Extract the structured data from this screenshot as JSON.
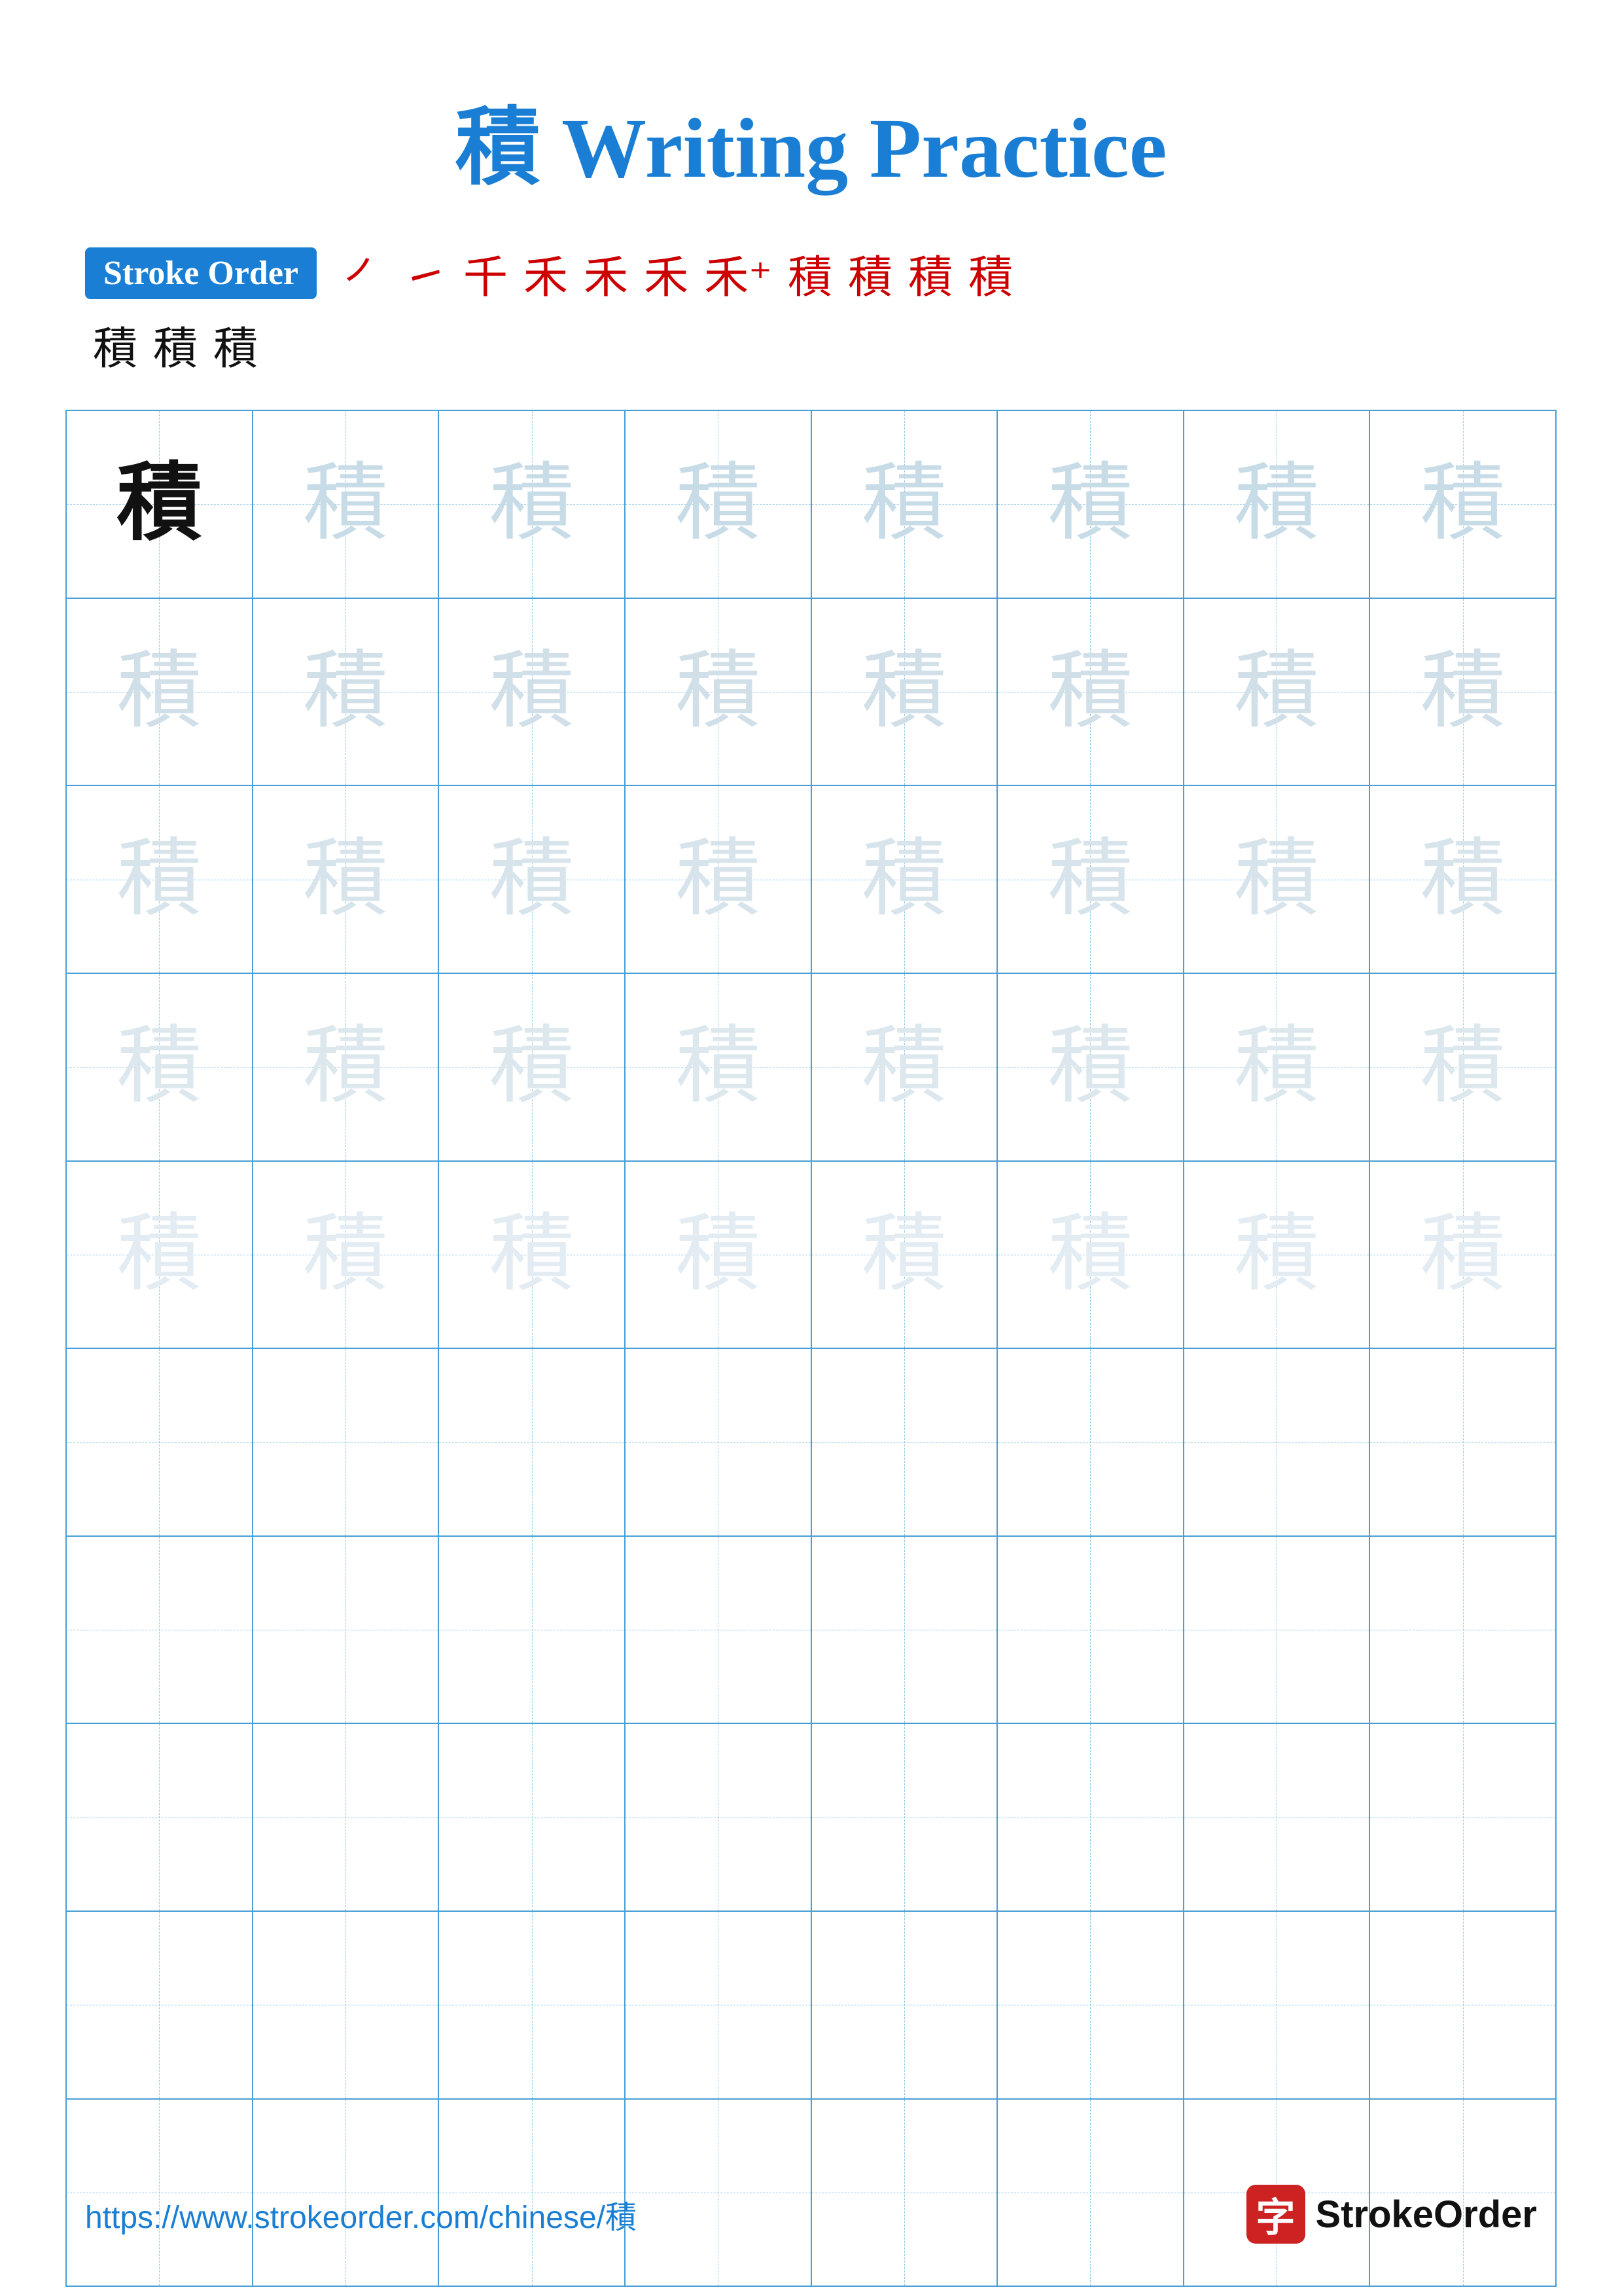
{
  "title": {
    "char": "積",
    "text": " Writing Practice"
  },
  "stroke_order": {
    "badge_label": "Stroke Order",
    "strokes": [
      "㇒",
      "㇀",
      "千",
      "禾",
      "禾",
      "禾",
      "禾†",
      "積",
      "積",
      "積",
      "積",
      "積",
      "積",
      "積"
    ]
  },
  "character": "積",
  "grid": {
    "cols": 8,
    "practice_rows": 5,
    "empty_rows": 5
  },
  "footer": {
    "url": "https://www.strokeorder.com/chinese/積",
    "logo_char": "字",
    "logo_text": "StrokeOrder"
  }
}
